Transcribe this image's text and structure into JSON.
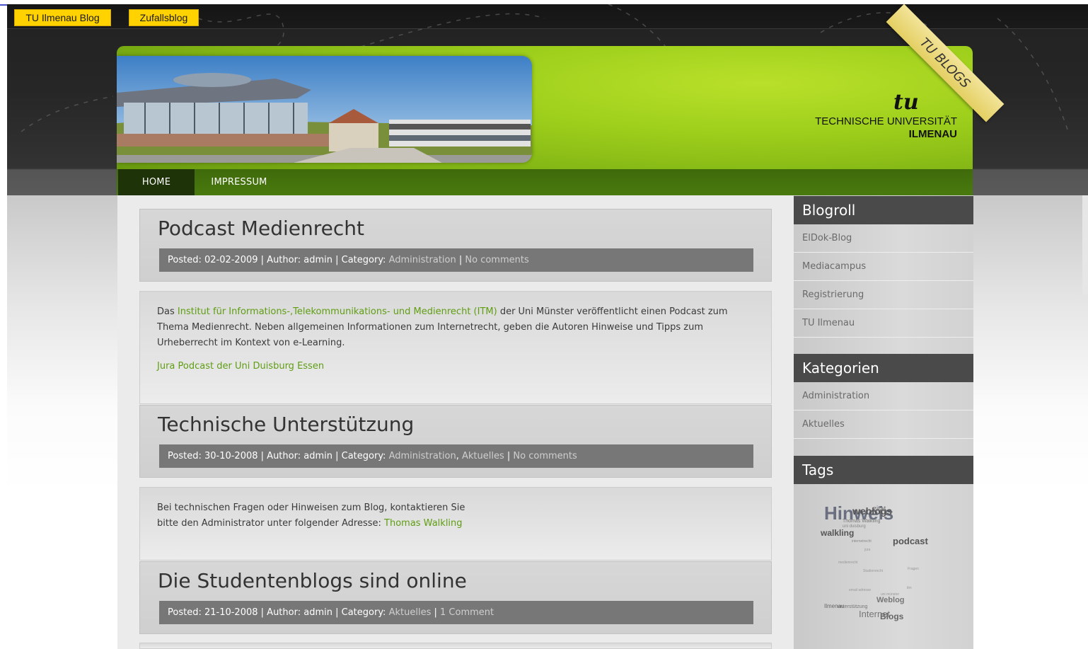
{
  "top_buttons": {
    "blog": "TU Ilmenau Blog",
    "random": "Zufallsblog"
  },
  "header": {
    "ribbon": "TU BLOGS",
    "logo_mark": "tu",
    "logo_line1": "TECHNISCHE UNIVERSITÄT",
    "logo_line2": "ILMENAU"
  },
  "nav": {
    "items": [
      {
        "label": "HOME"
      },
      {
        "label": "IMPRESSUM"
      }
    ]
  },
  "posts": [
    {
      "title": "Podcast Medienrecht",
      "meta": {
        "posted": "Posted: 02-02-2009",
        "author": "Author: admin",
        "category_label": "Category:",
        "categories": "Administration",
        "comments": "No comments"
      },
      "body": {
        "text_pre": "Das ",
        "link": "Institut für Informations-,Telekommunikations- und Medienrecht (ITM)",
        "text_post": " der Uni Münster veröffentlicht einen Podcast zum Thema Medienrecht. Neben allgemeinen Informationen zum Internetrecht, geben die Autoren Hinweise und Tipps zum Urheberrecht im Kontext von e-Learning.",
        "extra_link": "Jura Podcast der Uni Duisburg Essen"
      }
    },
    {
      "title": "Technische Unterstützung",
      "meta": {
        "posted": "Posted: 30-10-2008",
        "author": "Author: admin",
        "category_label": "Category:",
        "categories": "Administration",
        "categories2": "Aktuelles",
        "comments": "No comments"
      },
      "body": {
        "line1": "Bei technischen Fragen oder Hinweisen zum Blog, kontaktieren Sie",
        "line2": "bitte den Administrator unter folgender Adresse: ",
        "link": "Thomas Walkling"
      }
    },
    {
      "title": "Die Studentenblogs sind online",
      "meta": {
        "posted": "Posted: 21-10-2008",
        "author": "Author: admin",
        "category_label": "Category:",
        "categories": "Aktuelles",
        "comments": "1 Comment"
      }
    }
  ],
  "sidebar": {
    "blogroll": {
      "title": "Blogroll",
      "items": [
        "ElDok-Blog",
        "Mediacampus",
        "Registrierung",
        "TU Ilmenau"
      ]
    },
    "categories": {
      "title": "Kategorien",
      "items": [
        "Administration",
        "Aktuelles"
      ]
    },
    "tags": {
      "title": "Tags",
      "cloud": {
        "hinweis": "Hinweis",
        "weblogs": "weblogs",
        "zitat": "zitat",
        "walkling": "walkling",
        "podcast": "podcast",
        "thomas_walkling": "Thomas Walkling",
        "uni_duisburg": "uni duisburg",
        "weblog": "Weblog",
        "ilmenau": "Ilmenau",
        "unterstuetzung": "unterstützung",
        "internet": "Internet",
        "blogs": "Blogs",
        "studienrecht": "Studienrecht",
        "medienrecht": "medienrecht",
        "jura": "jura",
        "fragen": "Fragen",
        "email": "email adresse",
        "uni_muenster": "uni münster",
        "itm": "itm",
        "internetrecht": "internetrecht"
      }
    }
  }
}
